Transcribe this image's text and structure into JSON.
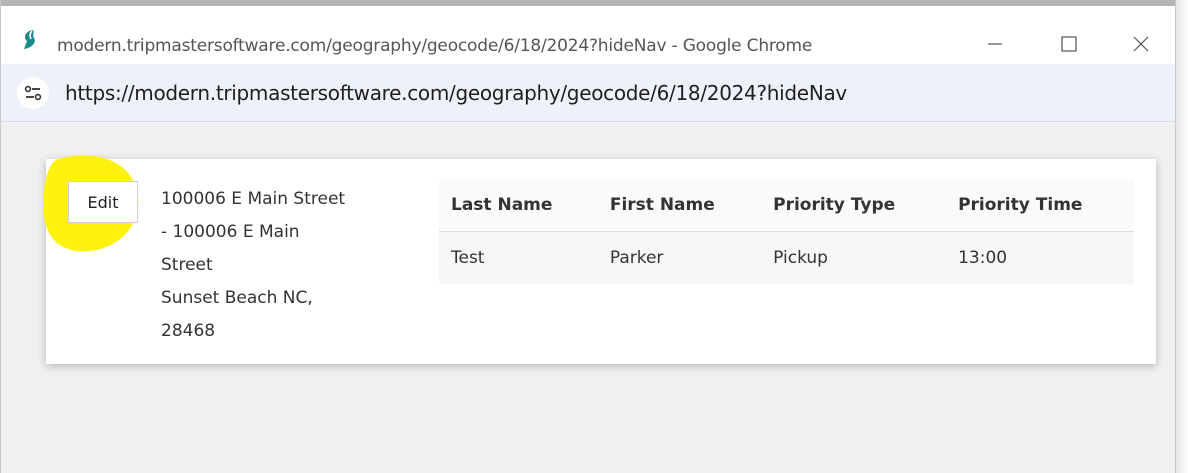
{
  "window": {
    "title": "modern.tripmastersoftware.com/geography/geocode/6/18/2024?hideNav - Google Chrome",
    "url": "https://modern.tripmastersoftware.com/geography/geocode/6/18/2024?hideNav",
    "controls": {
      "minimize_icon": "minimize-icon",
      "maximize_icon": "maximize-icon",
      "close_icon": "close-icon"
    },
    "app_icon": "tripmaster-logo-icon",
    "site_info_icon": "site-settings-icon"
  },
  "card": {
    "edit_label": "Edit",
    "address_lines": [
      "100006 E Main Street",
      "- 100006 E Main",
      "Street",
      "Sunset Beach NC,",
      "28468"
    ],
    "table": {
      "columns": [
        "Last Name",
        "First Name",
        "Priority Type",
        "Priority Time"
      ],
      "rows": [
        [
          "Test",
          "Parker",
          "Pickup",
          "13:00"
        ]
      ]
    }
  },
  "colors": {
    "highlight": "#fff200",
    "address_bar_bg": "#eef1fa",
    "content_bg": "#f0f0f0",
    "logo": "#1a8a8a"
  }
}
